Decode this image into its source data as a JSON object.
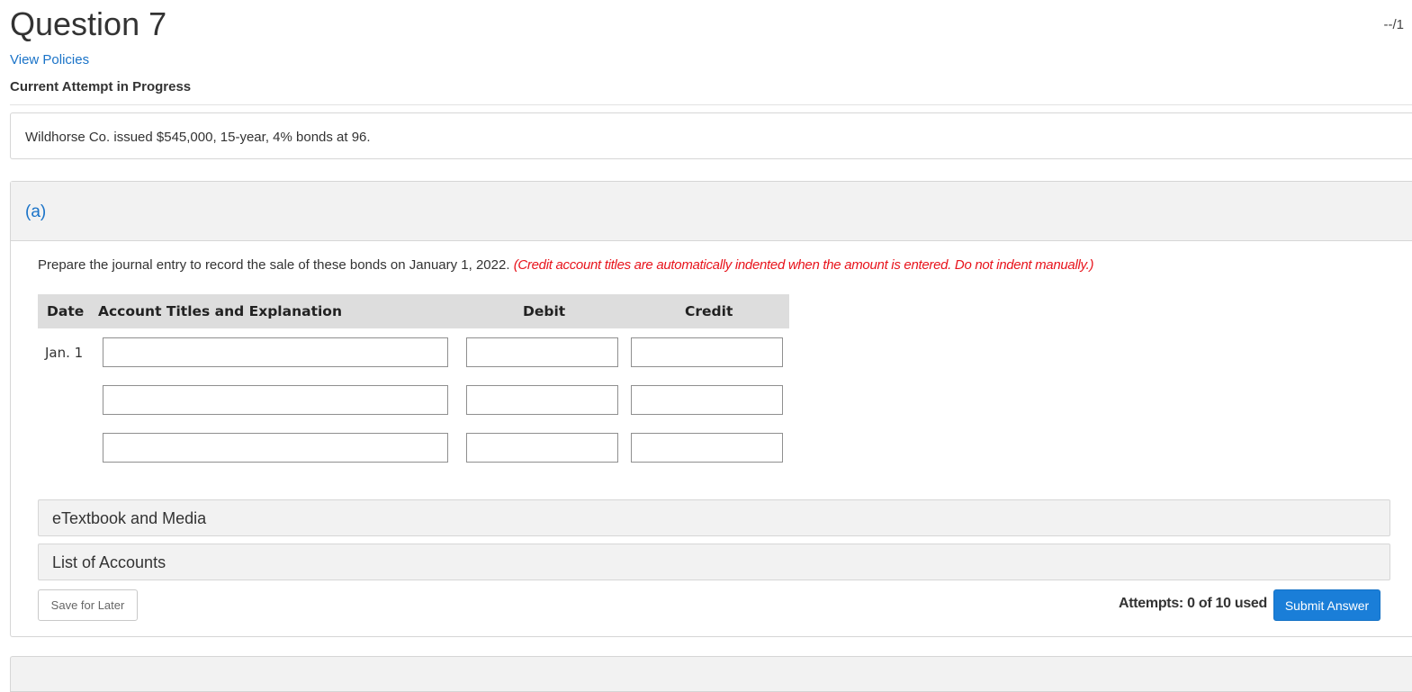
{
  "question": {
    "title": "Question 7",
    "score": "--/1"
  },
  "links": {
    "view_policies": "View Policies"
  },
  "status": "Current Attempt in Progress",
  "problem": {
    "text": "Wildhorse Co. issued $545,000, 15-year, 4% bonds at 96."
  },
  "part": {
    "label": "(a)",
    "instructions": "Prepare the journal entry to record the sale of these bonds on January 1, 2022.",
    "note": "(Credit account titles are automatically indented when the amount is entered. Do not indent manually.)"
  },
  "journal": {
    "headers": {
      "date": "Date",
      "account": "Account Titles and Explanation",
      "debit": "Debit",
      "credit": "Credit"
    },
    "rows": [
      {
        "date": "Jan. 1",
        "account": "",
        "debit": "",
        "credit": ""
      },
      {
        "date": "",
        "account": "",
        "debit": "",
        "credit": ""
      },
      {
        "date": "",
        "account": "",
        "debit": "",
        "credit": ""
      }
    ]
  },
  "accordions": {
    "etextbook": "eTextbook and Media",
    "accounts": "List of Accounts"
  },
  "footer": {
    "save_label": "Save for Later",
    "attempts_text": "Attempts: 0 of 10 used",
    "submit_label": "Submit Answer"
  },
  "colors": {
    "link": "#1a73c8",
    "note": "#e8141c",
    "submit": "#1a7ed8"
  }
}
